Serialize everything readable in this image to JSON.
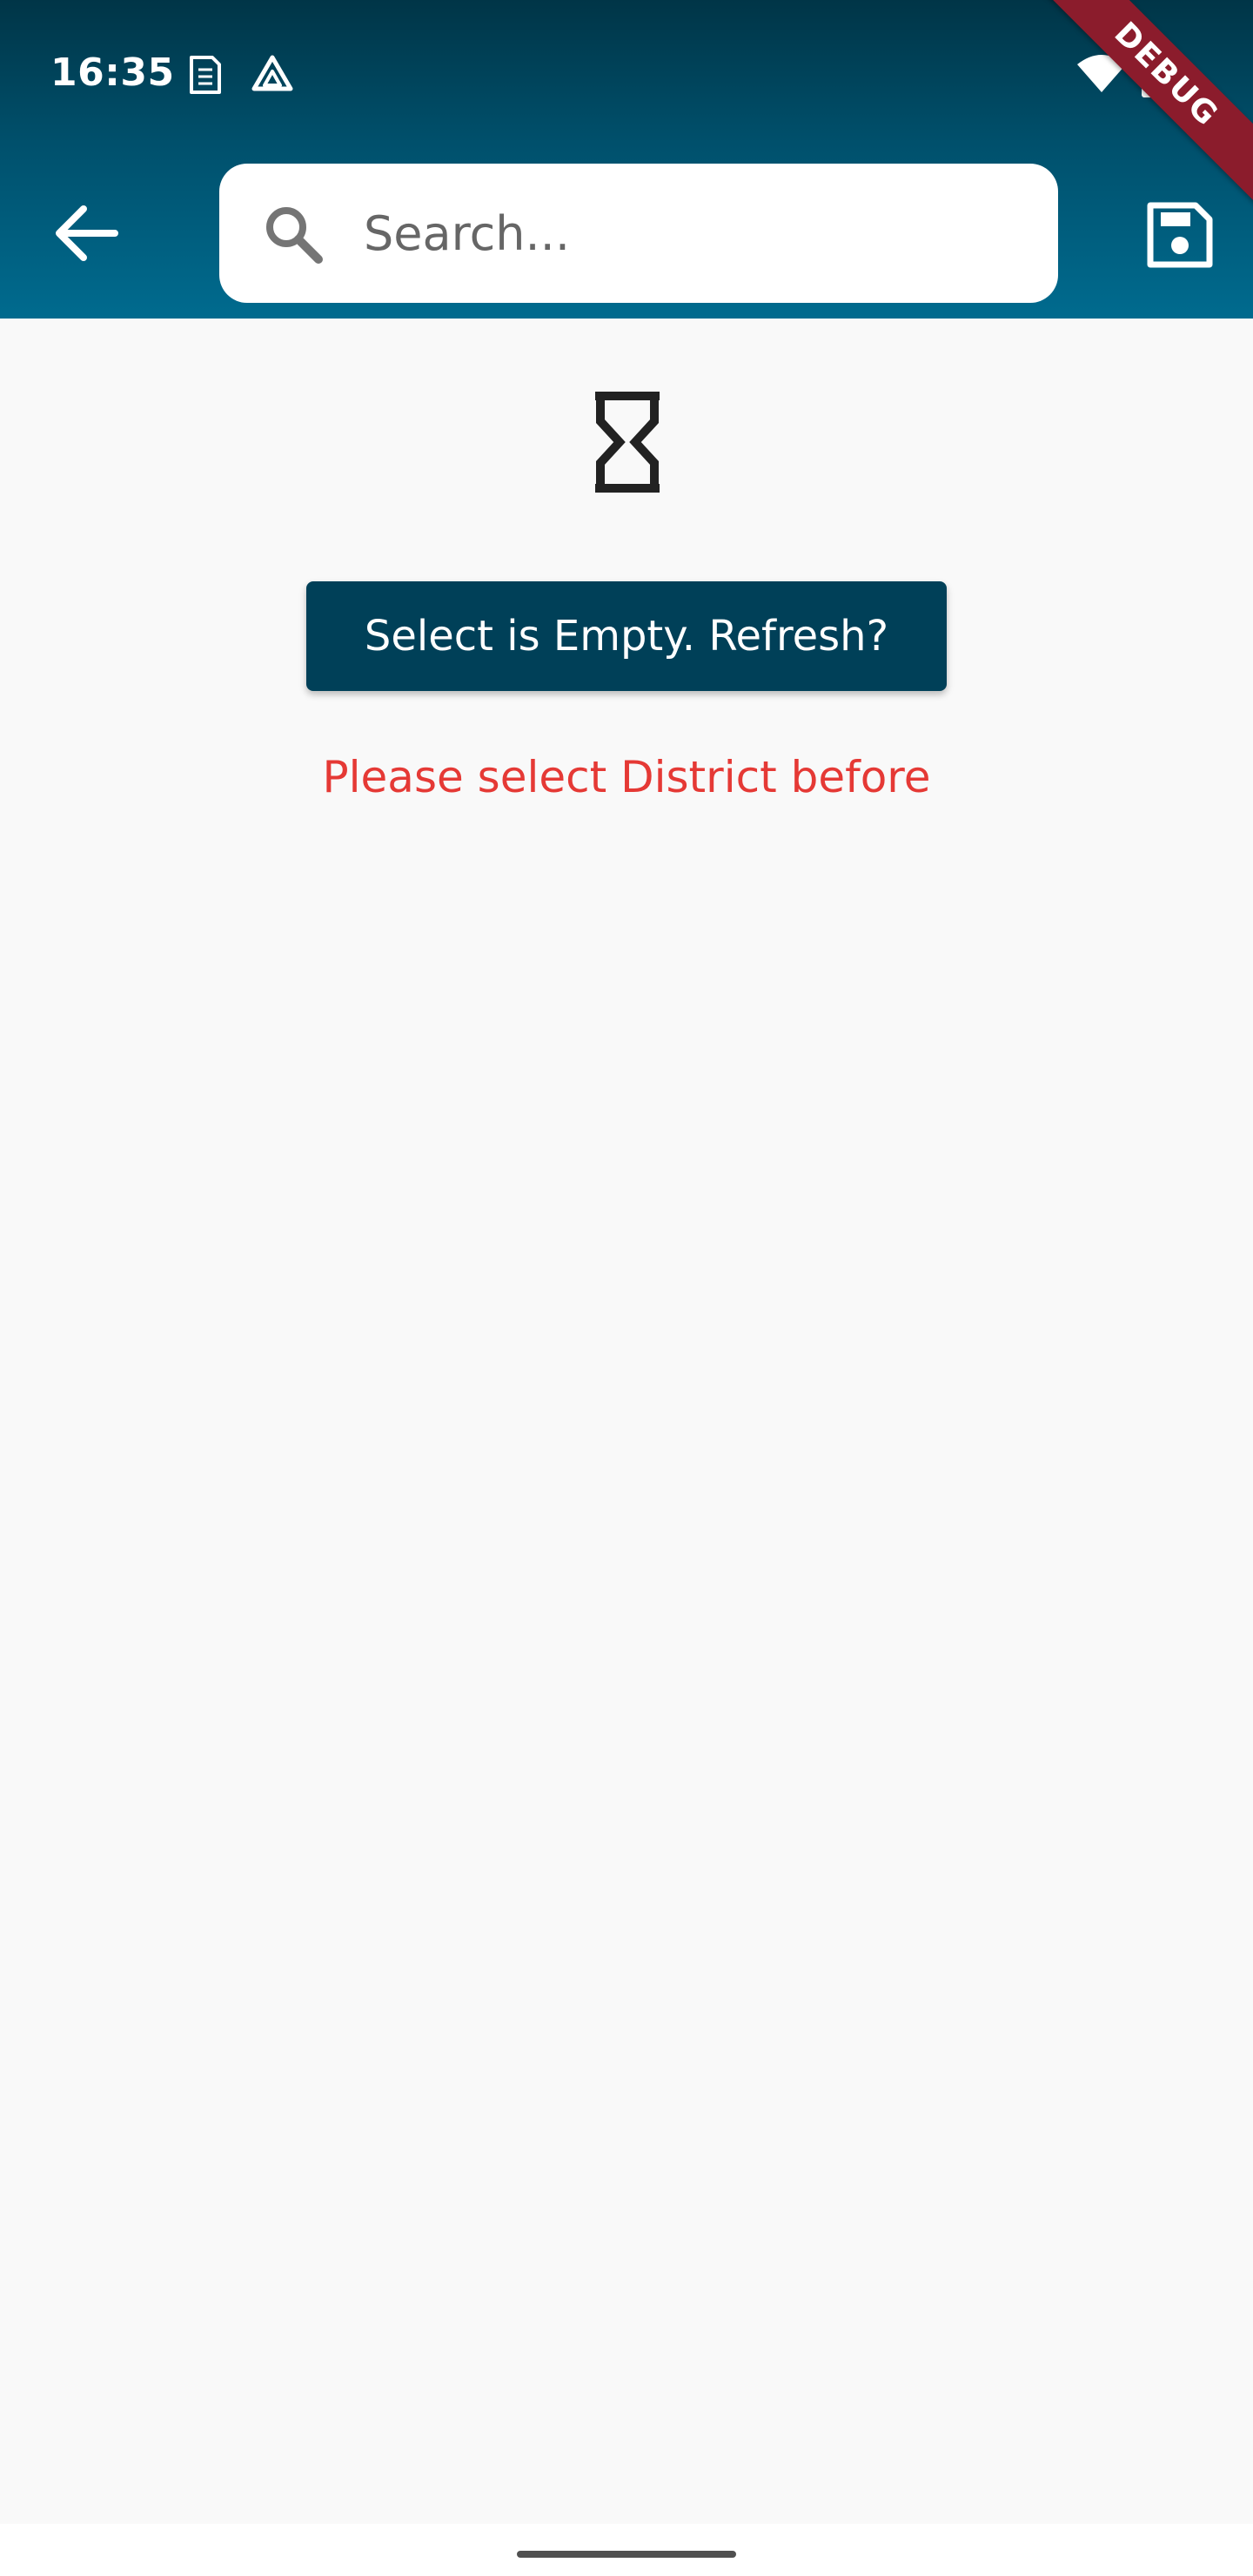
{
  "status_bar": {
    "time": "16:35",
    "icons": [
      "sim-card-icon",
      "drive-icon",
      "wifi-icon",
      "battery-charging-icon"
    ]
  },
  "debug_banner": "DEBUG",
  "app_bar": {
    "back_icon": "arrow-back-icon",
    "search": {
      "placeholder": "Search...",
      "value": "",
      "icon": "search-icon"
    },
    "save_icon": "save-icon"
  },
  "content": {
    "status_icon": "hourglass-icon",
    "refresh_button_label": "Select is Empty. Refresh?",
    "error_message": "Please select District before"
  },
  "colors": {
    "app_bar_gradient_top": "#003547",
    "app_bar_gradient_bottom": "#006b8f",
    "primary_button": "#004058",
    "error_text": "#e53935",
    "background": "#f9f9f9",
    "debug_ribbon": "#8b1c2c"
  }
}
